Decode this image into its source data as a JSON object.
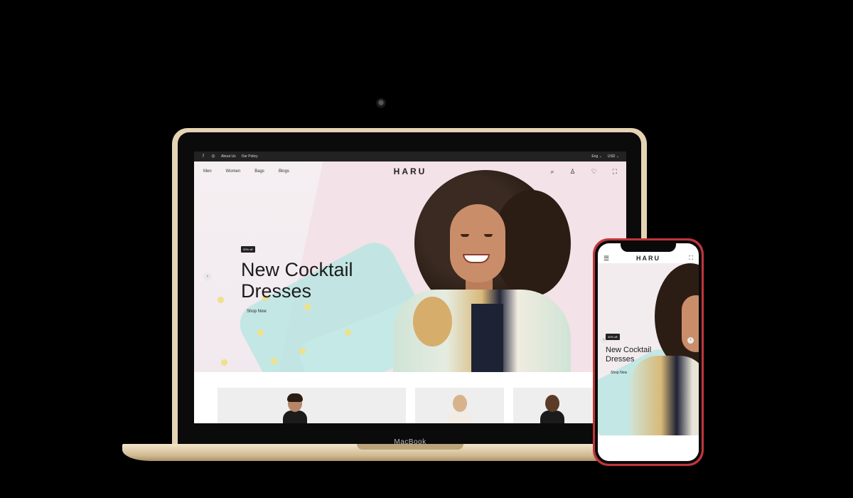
{
  "laptop": {
    "brand_label": "MacBook",
    "site": {
      "topbar": {
        "social": [
          "f",
          "◎"
        ],
        "links": [
          "About Us",
          "Our Policy"
        ],
        "language": "Eng",
        "currency": "USD"
      },
      "nav": {
        "links": [
          "Men",
          "Women",
          "Bags",
          "Blogs"
        ],
        "brand": "HARU",
        "icons": [
          "search-icon",
          "user-icon",
          "heart-icon",
          "bag-icon"
        ]
      },
      "hero": {
        "badge": "30% off",
        "title": "New Cocktail Dresses",
        "cta": "Shop Now"
      }
    }
  },
  "phone": {
    "brand": "HARU",
    "hero": {
      "badge": "30% off",
      "title": "New Cocktail Dresses",
      "cta": "Shop Now"
    }
  }
}
